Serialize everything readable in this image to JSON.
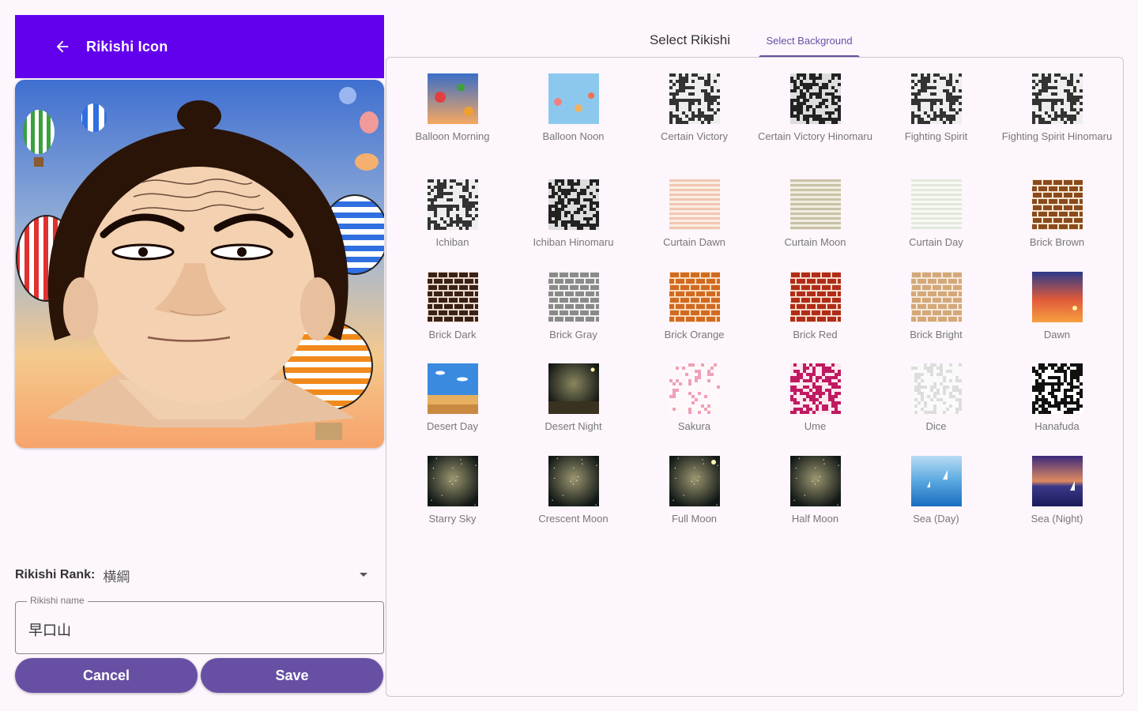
{
  "appbar": {
    "title": "Rikishi Icon",
    "back_icon": "arrow-left-icon"
  },
  "tabs": [
    {
      "label": "Select Rikishi",
      "selected": false
    },
    {
      "label": "Select Background",
      "selected": true
    }
  ],
  "backgrounds": [
    {
      "label": "Balloon Morning",
      "pattern": "balloon-morning"
    },
    {
      "label": "Balloon Noon",
      "pattern": "balloon-noon"
    },
    {
      "label": "Certain Victory",
      "pattern": "noise-gray"
    },
    {
      "label": "Certain Victory Hinomaru",
      "pattern": "noise-dark"
    },
    {
      "label": "Fighting Spirit",
      "pattern": "noise-gray"
    },
    {
      "label": "Fighting Spirit Hinomaru",
      "pattern": "noise-gray"
    },
    {
      "label": "Ichiban",
      "pattern": "noise-gray"
    },
    {
      "label": "Ichiban Hinomaru",
      "pattern": "noise-dark"
    },
    {
      "label": "Curtain Dawn",
      "pattern": "curtain-dawn"
    },
    {
      "label": "Curtain Moon",
      "pattern": "curtain-moon"
    },
    {
      "label": "Curtain Day",
      "pattern": "curtain-day"
    },
    {
      "label": "Brick Brown",
      "pattern": "brick-brown"
    },
    {
      "label": "Brick Dark",
      "pattern": "brick-dark"
    },
    {
      "label": "Brick Gray",
      "pattern": "brick-gray"
    },
    {
      "label": "Brick Orange",
      "pattern": "brick-orange"
    },
    {
      "label": "Brick Red",
      "pattern": "brick-red"
    },
    {
      "label": "Brick Bright",
      "pattern": "brick-bright"
    },
    {
      "label": "Dawn",
      "pattern": "dawn"
    },
    {
      "label": "Desert Day",
      "pattern": "desert-day"
    },
    {
      "label": "Desert Night",
      "pattern": "desert-night"
    },
    {
      "label": "Sakura",
      "pattern": "sakura"
    },
    {
      "label": "Ume",
      "pattern": "ume"
    },
    {
      "label": "Dice",
      "pattern": "dice"
    },
    {
      "label": "Hanafuda",
      "pattern": "hanafuda"
    },
    {
      "label": "Starry Sky",
      "pattern": "starry"
    },
    {
      "label": "Crescent Moon",
      "pattern": "starry"
    },
    {
      "label": "Full Moon",
      "pattern": "starry-moon"
    },
    {
      "label": "Half Moon",
      "pattern": "starry"
    },
    {
      "label": "Sea (Day)",
      "pattern": "sea-day"
    },
    {
      "label": "Sea (Night)",
      "pattern": "sea-night"
    }
  ],
  "rank": {
    "label": "Rikishi Rank:",
    "value": "横綱"
  },
  "name_field": {
    "legend": "Rikishi name",
    "value": "早口山"
  },
  "buttons": {
    "cancel": "Cancel",
    "save": "Save"
  },
  "colors": {
    "appbar": "#6200ee",
    "button": "#6750a4",
    "tab_selected": "#6750a4"
  }
}
